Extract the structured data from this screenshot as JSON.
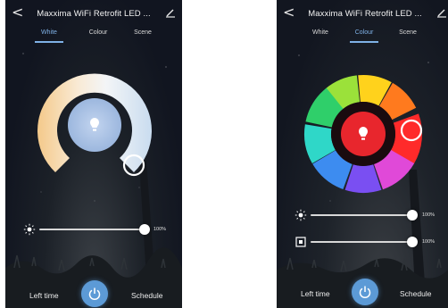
{
  "left_screen": {
    "header": {
      "back_glyph": "<",
      "title": "Maxxima WiFi Retrofit LED ...",
      "edit_icon": "pencil-icon"
    },
    "tabs": [
      {
        "label": "White",
        "active": true
      },
      {
        "label": "Colour",
        "active": false
      },
      {
        "label": "Scene",
        "active": false
      }
    ],
    "brightness": {
      "icon": "sun-icon",
      "value_label": "100%",
      "level": 1.0
    },
    "bottom": {
      "left_label": "Left time",
      "right_label": "Schedule",
      "power_icon": "power-icon"
    },
    "colors": {
      "accent": "#7fb1e6",
      "power": "#5c9ad6",
      "bulb_glow": "#a9c3e7"
    }
  },
  "right_screen": {
    "header": {
      "back_glyph": "<",
      "title": "Maxxima WiFi Retrofit LED ...",
      "edit_icon": "pencil-icon"
    },
    "tabs": [
      {
        "label": "White",
        "active": false
      },
      {
        "label": "Colour",
        "active": true
      },
      {
        "label": "Scene",
        "active": false
      }
    ],
    "brightness": {
      "icon": "sun-icon",
      "value_label": "100%",
      "level": 1.0
    },
    "saturation": {
      "icon": "saturation-icon",
      "value_label": "100%",
      "level": 1.0
    },
    "bottom": {
      "left_label": "Left time",
      "right_label": "Schedule",
      "power_icon": "power-icon"
    },
    "colors": {
      "accent": "#7fb1e6",
      "power": "#5c9ad6",
      "selected_colour": "#e8262d"
    }
  }
}
